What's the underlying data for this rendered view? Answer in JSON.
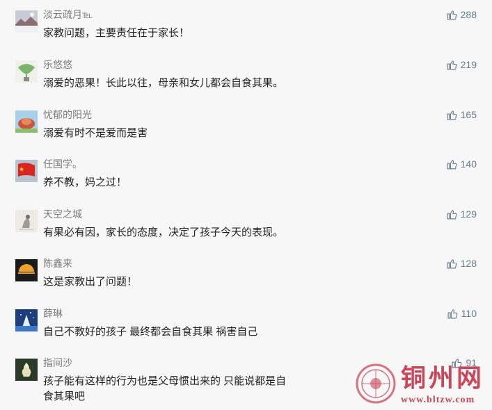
{
  "comments": [
    {
      "username": "淡云疏月℡",
      "text": "家教问题，主要责任在于家长！",
      "likes": "288",
      "avatar_icon": "snowy-landscape-avatar"
    },
    {
      "username": "乐悠悠",
      "text": "溺爱的恶果！长此以往，母亲和女儿都会自食其果。",
      "likes": "219",
      "avatar_icon": "ginkgo-leaf-avatar"
    },
    {
      "username": "忧郁的阳光",
      "text": "溺爱有时不是爱而是害",
      "likes": "165",
      "avatar_icon": "flower-avatar"
    },
    {
      "username": "任国学。",
      "text": "养不教，妈之过！",
      "likes": "140",
      "avatar_icon": "red-flag-avatar"
    },
    {
      "username": "天空之城",
      "text": "有果必有因，家长的态度，决定了孩子今天的表现。",
      "likes": "129",
      "avatar_icon": "sketch-avatar"
    },
    {
      "username": "陈鑫来",
      "text": "这是家教出了问题！",
      "likes": "128",
      "avatar_icon": "sunset-avatar"
    },
    {
      "username": "薛琳",
      "text": "自己不教好的孩子 最终都会自食其果 祸害自己",
      "likes": "110",
      "avatar_icon": "night-sky-avatar"
    },
    {
      "username": "指间沙",
      "text": "孩子能有这样的行为也是父母惯出来的 只能说都是自食其果吧",
      "likes": "91",
      "avatar_icon": "lotus-avatar"
    }
  ],
  "like_icon": "thumbs-up-icon",
  "watermark": {
    "title": "铜州网",
    "url": "www.bltzw.com"
  },
  "colors": {
    "username": "#7b7b7b",
    "text": "#222222",
    "like": "#6a7a90",
    "watermark": "#c9475a"
  }
}
